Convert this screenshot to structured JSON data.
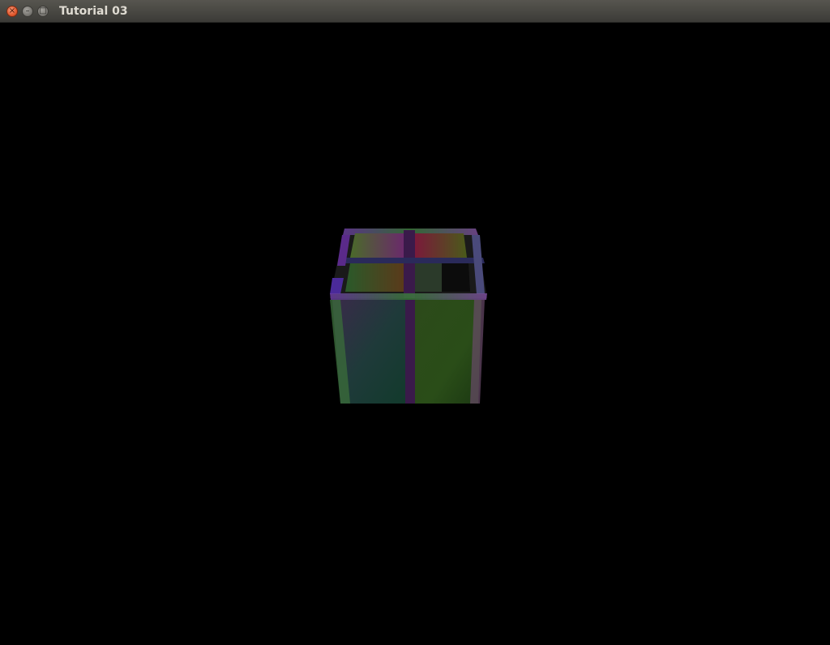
{
  "window": {
    "title": "Tutorial 03",
    "close_icon": "×",
    "minimize_icon": "–",
    "maximize_icon": "□"
  },
  "viewport": {
    "background": "#000000",
    "object": "cube-icon"
  }
}
